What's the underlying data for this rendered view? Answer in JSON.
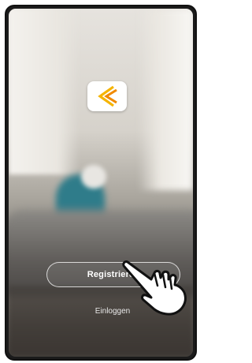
{
  "app": {
    "logo_icon": "app-logo-chevrons",
    "logo_colors": [
      "#f5b400",
      "#f08a00"
    ]
  },
  "actions": {
    "register_label": "Registrieren",
    "login_label": "Einloggen"
  },
  "overlay": {
    "pointer_icon": "hand-pointer-icon"
  }
}
